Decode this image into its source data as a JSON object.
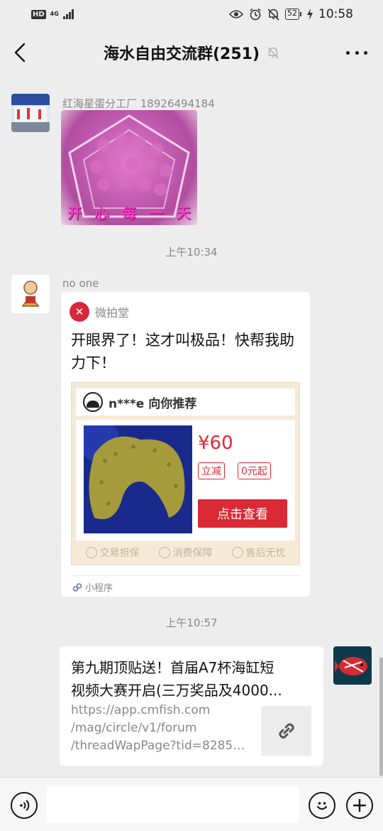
{
  "status_bar": {
    "hd": "HD",
    "network": "4G",
    "battery": "52",
    "time": "10:58",
    "icons": [
      "eye-icon",
      "alarm-icon",
      "mute-bell-icon",
      "charging-icon"
    ]
  },
  "header": {
    "title": "海水自由交流群(251)",
    "icons": [
      "back-chevron-icon",
      "mute-bell-icon",
      "more-dots-icon"
    ]
  },
  "messages": [
    {
      "type": "image",
      "sender": "红海星蛋分工厂 18926494184",
      "image_caption": [
        "开",
        "心",
        "每",
        "一",
        "天"
      ]
    },
    {
      "type": "timestamp",
      "text": "上午10:34"
    },
    {
      "type": "miniprogram",
      "sender": "no one",
      "app_name": "微拍堂",
      "description": "开眼界了！这才叫极品！快帮我助力下！",
      "preview": {
        "recommend_text": "n***e 向你推荐",
        "price": "¥60",
        "tags": [
          "立减",
          "0元起"
        ],
        "cta": "点击查看",
        "guarantees": [
          "交易担保",
          "消费保障",
          "售后无忧"
        ]
      },
      "footer": "小程序"
    },
    {
      "type": "timestamp",
      "text": "上午10:57"
    },
    {
      "type": "link",
      "outgoing": true,
      "title_line1": "第九期顶贴送！首届A7杯海缸短",
      "title_line2": "视频大赛开启(三万奖品及4000...",
      "url_line1": "https://app.cmfish.com",
      "url_line2": "/mag/circle/v1/forum",
      "url_line3": "/threadWapPage?tid=82852...",
      "thumb_icon": "link-icon"
    }
  ],
  "input_bar": {
    "icons": [
      "voice-icon",
      "emoji-icon",
      "plus-icon"
    ]
  },
  "colors": {
    "background": "#ededed",
    "accent_red": "#e02834",
    "bubble": "#ffffff"
  }
}
